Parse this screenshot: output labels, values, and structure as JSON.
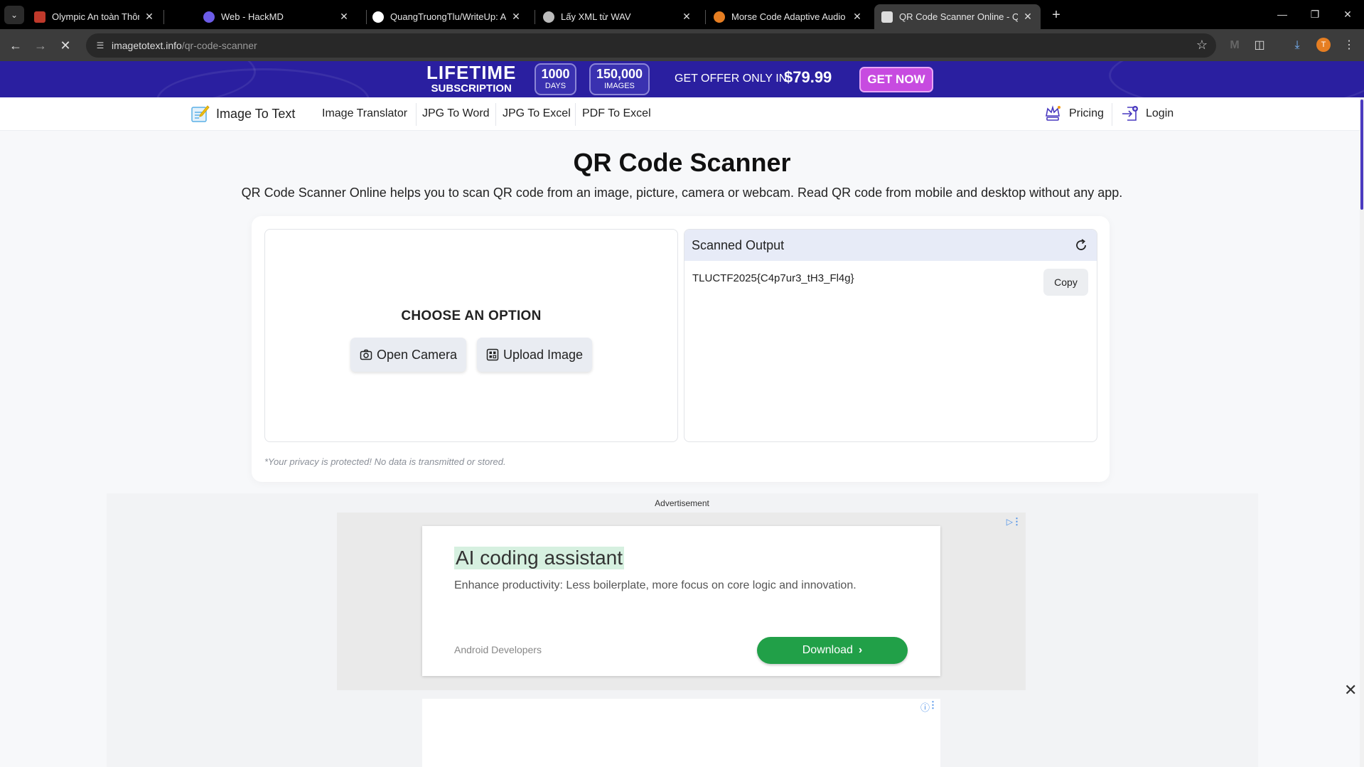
{
  "browser": {
    "tabs": [
      {
        "title": "Olympic An toàn Thông tin cấp",
        "favicon_color": "#c0392b"
      },
      {
        "title": "Web - HackMD",
        "favicon_color": "#6c5ce7"
      },
      {
        "title": "QuangTruongTlu/WriteUp: A pl",
        "favicon_color": "#ffffff"
      },
      {
        "title": "Lấy XML từ WAV",
        "favicon_color": "#bbbbbb"
      },
      {
        "title": "Morse Code Adaptive Audio De",
        "favicon_color": "#e67e22"
      },
      {
        "title": "QR Code Scanner Online - QR C",
        "favicon_color": "#dddddd"
      }
    ],
    "active_tab_index": 5,
    "url_domain": "imagetotext.info",
    "url_path": "/qr-code-scanner",
    "profile_initial": "T"
  },
  "promo": {
    "lifetime": "LIFETIME",
    "subscription": "SUBSCRIPTION",
    "days_value": "1000",
    "days_unit": "DAYS",
    "images_value": "150,000",
    "images_unit": "IMAGES",
    "offer_text": "GET OFFER ONLY IN",
    "price": "$79.99",
    "cta": "GET NOW"
  },
  "nav": {
    "logo_text": "Image To Text",
    "links": [
      "Image Translator",
      "JPG To Word",
      "JPG To Excel",
      "PDF To Excel"
    ],
    "pricing": "Pricing",
    "login": "Login"
  },
  "main": {
    "title": "QR Code Scanner",
    "subtitle": "QR Code Scanner Online helps you to scan QR code from an image, picture, camera or webcam. Read QR code from mobile and desktop without any app.",
    "choose_label": "CHOOSE AN OPTION",
    "open_camera": "Open Camera",
    "upload_image": "Upload Image",
    "output_title": "Scanned Output",
    "output_value": "TLUCTF2025{C4p7ur3_tH3_Fl4g}",
    "copy_label": "Copy",
    "privacy_note": "*Your privacy is protected! No data is transmitted or stored."
  },
  "ads": {
    "label": "Advertisement",
    "title": "AI coding assistant",
    "description": "Enhance productivity: Less boilerplate, more focus on core logic and innovation.",
    "source": "Android Developers",
    "cta": "Download"
  },
  "colors": {
    "promo_bg": "#2a1fa0",
    "get_now": "#c74be0",
    "download_green": "#21a048",
    "output_header": "#e7ebf7"
  }
}
